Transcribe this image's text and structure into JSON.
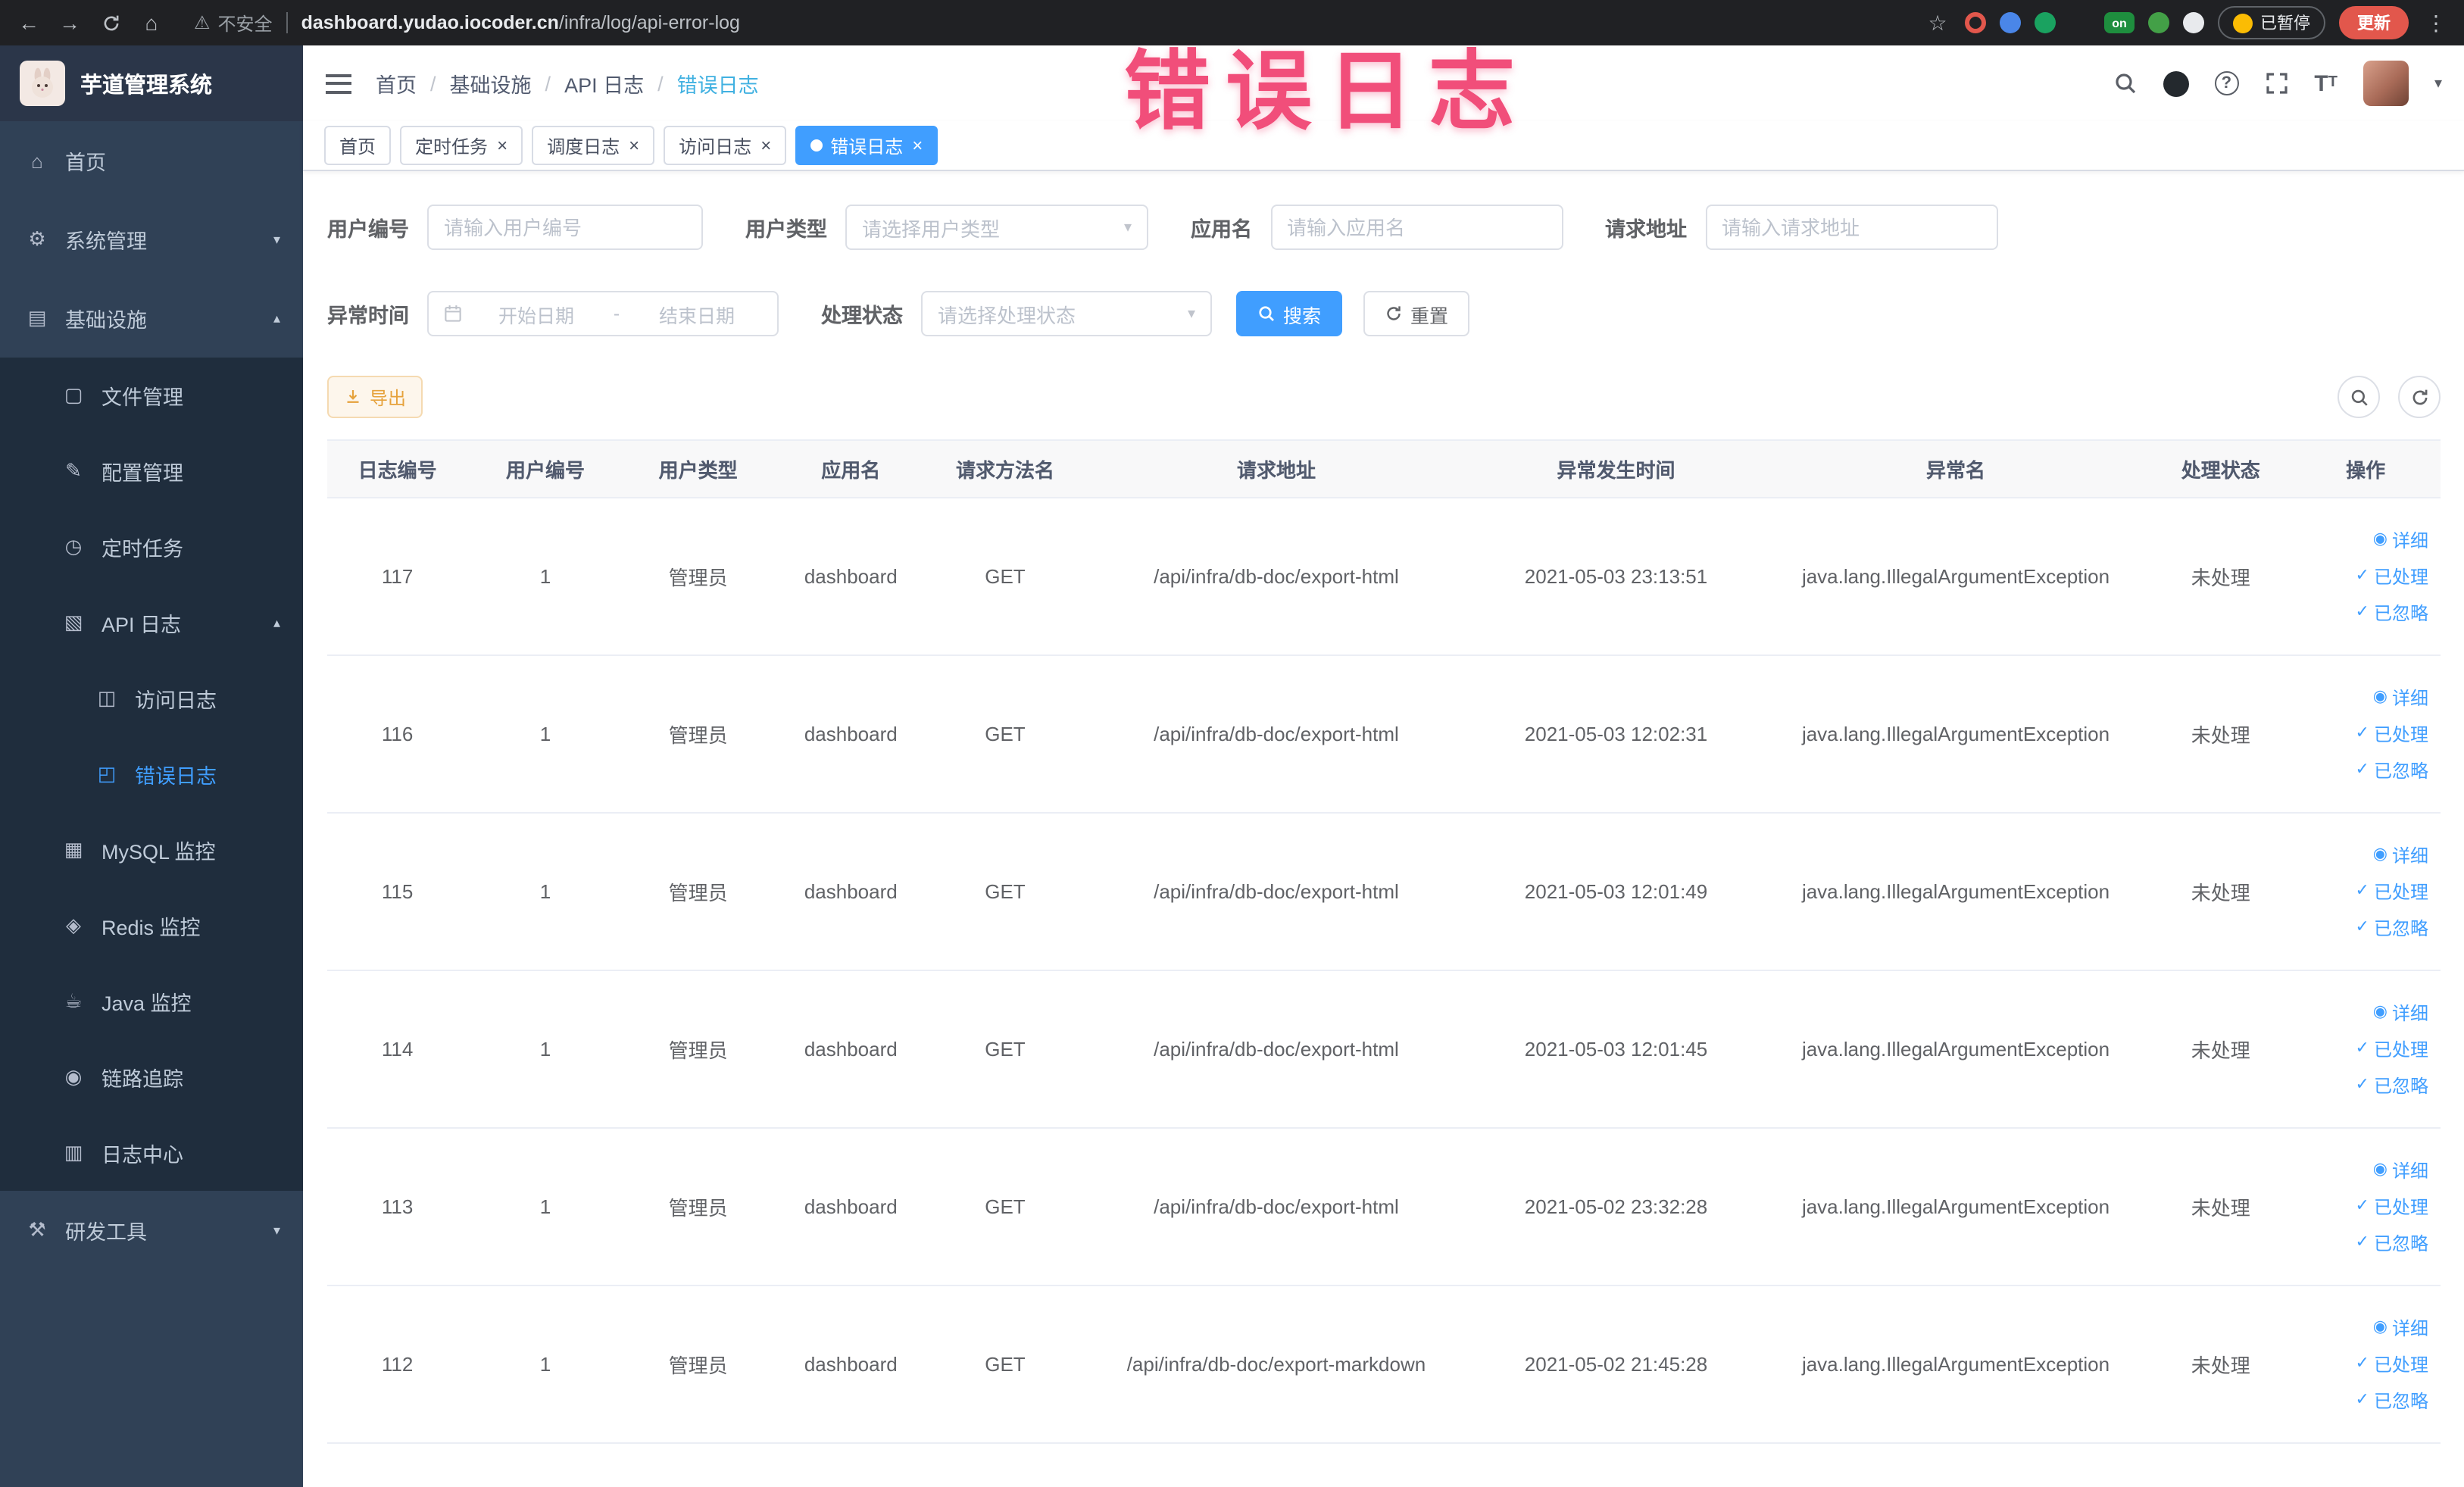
{
  "annotation": {
    "title": "错误日志"
  },
  "browser": {
    "security_label": "不安全",
    "url_domain": "dashboard.yudao.iocoder.cn",
    "url_path": "/infra/log/api-error-log",
    "extension_on_badge": "on",
    "paused_label": "已暂停",
    "update_label": "更新"
  },
  "sidebar": {
    "logo_title": "芋道管理系统",
    "menu": [
      {
        "label": "首页",
        "icon": "home-icon",
        "glyph": "⌂",
        "level": 1
      },
      {
        "label": "系统管理",
        "icon": "system-management-icon",
        "glyph": "⚙",
        "level": 1,
        "arrow": "down"
      },
      {
        "label": "基础设施",
        "icon": "infrastructure-icon",
        "glyph": "▤",
        "level": 1,
        "arrow": "up"
      },
      {
        "label": "文件管理",
        "icon": "file-management-icon",
        "glyph": "▢",
        "level": 2
      },
      {
        "label": "配置管理",
        "icon": "config-management-icon",
        "glyph": "✎",
        "level": 2
      },
      {
        "label": "定时任务",
        "icon": "scheduled-job-icon",
        "glyph": "◷",
        "level": 2
      },
      {
        "label": "API 日志",
        "icon": "api-log-icon",
        "glyph": "▧",
        "level": 2,
        "arrow": "up"
      },
      {
        "label": "访问日志",
        "icon": "access-log-icon",
        "glyph": "◫",
        "level": 3
      },
      {
        "label": "错误日志",
        "icon": "error-log-icon",
        "glyph": "◰",
        "level": 3,
        "active": true
      },
      {
        "label": "MySQL 监控",
        "icon": "mysql-monitor-icon",
        "glyph": "▦",
        "level": 2
      },
      {
        "label": "Redis 监控",
        "icon": "redis-monitor-icon",
        "glyph": "◈",
        "level": 2
      },
      {
        "label": "Java 监控",
        "icon": "java-monitor-icon",
        "glyph": "☕",
        "level": 2
      },
      {
        "label": "链路追踪",
        "icon": "trace-icon",
        "glyph": "◉",
        "level": 2
      },
      {
        "label": "日志中心",
        "icon": "log-center-icon",
        "glyph": "▥",
        "level": 2
      },
      {
        "label": "研发工具",
        "icon": "dev-tools-icon",
        "glyph": "⚒",
        "level": 1,
        "arrow": "down"
      }
    ]
  },
  "header": {
    "breadcrumb": [
      "首页",
      "基础设施",
      "API 日志",
      "错误日志"
    ],
    "breadcrumb_separator": "/"
  },
  "tabs": [
    {
      "label": "首页",
      "closable": false,
      "active": false
    },
    {
      "label": "定时任务",
      "closable": true,
      "active": false
    },
    {
      "label": "调度日志",
      "closable": true,
      "active": false
    },
    {
      "label": "访问日志",
      "closable": true,
      "active": false
    },
    {
      "label": "错误日志",
      "closable": true,
      "active": true
    }
  ],
  "filters": {
    "user_id_label": "用户编号",
    "user_id_placeholder": "请输入用户编号",
    "user_type_label": "用户类型",
    "user_type_placeholder": "请选择用户类型",
    "app_name_label": "应用名",
    "app_name_placeholder": "请输入应用名",
    "request_url_label": "请求地址",
    "request_url_placeholder": "请输入请求地址",
    "exception_time_label": "异常时间",
    "date_start_placeholder": "开始日期",
    "date_separator": "-",
    "date_end_placeholder": "结束日期",
    "process_status_label": "处理状态",
    "process_status_placeholder": "请选择处理状态",
    "search_label": "搜索",
    "reset_label": "重置"
  },
  "toolbar": {
    "export_label": "导出"
  },
  "table": {
    "columns": [
      {
        "key": "id",
        "label": "日志编号"
      },
      {
        "key": "user_id",
        "label": "用户编号"
      },
      {
        "key": "user_type",
        "label": "用户类型"
      },
      {
        "key": "app",
        "label": "应用名"
      },
      {
        "key": "method",
        "label": "请求方法名"
      },
      {
        "key": "url",
        "label": "请求地址"
      },
      {
        "key": "time",
        "label": "异常发生时间"
      },
      {
        "key": "exception",
        "label": "异常名"
      },
      {
        "key": "status",
        "label": "处理状态"
      },
      {
        "key": "actions",
        "label": "操作"
      }
    ],
    "row_actions": [
      {
        "name": "detail",
        "label": "详细",
        "icon": "eye-icon",
        "glyph": "◉"
      },
      {
        "name": "processed",
        "label": "已处理",
        "icon": "check-icon",
        "glyph": "✓"
      },
      {
        "name": "ignored",
        "label": "已忽略",
        "icon": "check-icon",
        "glyph": "✓"
      }
    ],
    "rows": [
      {
        "id": "117",
        "user_id": "1",
        "user_type": "管理员",
        "app": "dashboard",
        "method": "GET",
        "url": "/api/infra/db-doc/export-html",
        "time": "2021-05-03 23:13:51",
        "exception": "java.lang.IllegalArgumentException",
        "status": "未处理"
      },
      {
        "id": "116",
        "user_id": "1",
        "user_type": "管理员",
        "app": "dashboard",
        "method": "GET",
        "url": "/api/infra/db-doc/export-html",
        "time": "2021-05-03 12:02:31",
        "exception": "java.lang.IllegalArgumentException",
        "status": "未处理"
      },
      {
        "id": "115",
        "user_id": "1",
        "user_type": "管理员",
        "app": "dashboard",
        "method": "GET",
        "url": "/api/infra/db-doc/export-html",
        "time": "2021-05-03 12:01:49",
        "exception": "java.lang.IllegalArgumentException",
        "status": "未处理"
      },
      {
        "id": "114",
        "user_id": "1",
        "user_type": "管理员",
        "app": "dashboard",
        "method": "GET",
        "url": "/api/infra/db-doc/export-html",
        "time": "2021-05-03 12:01:45",
        "exception": "java.lang.IllegalArgumentException",
        "status": "未处理"
      },
      {
        "id": "113",
        "user_id": "1",
        "user_type": "管理员",
        "app": "dashboard",
        "method": "GET",
        "url": "/api/infra/db-doc/export-html",
        "time": "2021-05-02 23:32:28",
        "exception": "java.lang.IllegalArgumentException",
        "status": "未处理"
      },
      {
        "id": "112",
        "user_id": "1",
        "user_type": "管理员",
        "app": "dashboard",
        "method": "GET",
        "url": "/api/infra/db-doc/export-markdown",
        "time": "2021-05-02 21:45:28",
        "exception": "java.lang.IllegalArgumentException",
        "status": "未处理"
      }
    ]
  }
}
